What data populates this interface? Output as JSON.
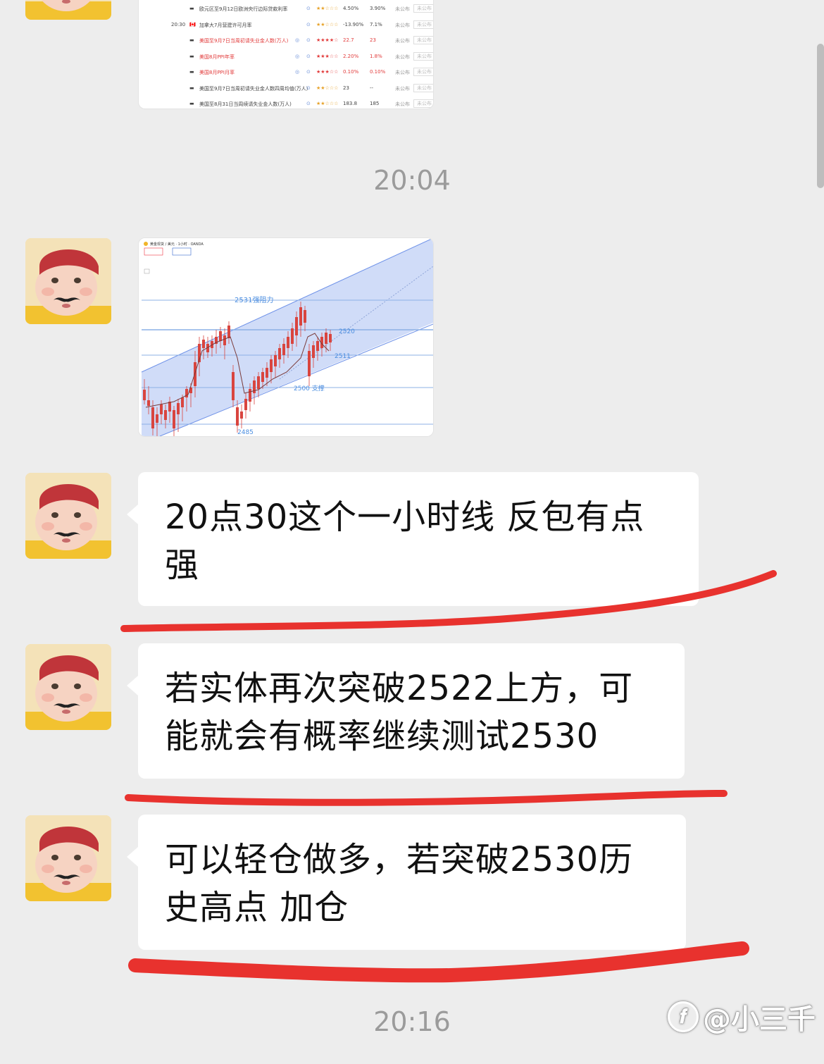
{
  "calendar": {
    "rows": [
      {
        "time": "",
        "flag": "eu",
        "event": "欧元区至9月12日欧洲央行边际贷款利率",
        "stars": "★★☆☆☆",
        "prev": "4.50%",
        "forecast": "3.90%",
        "actual": "未公布",
        "btn": "未公布",
        "red": false
      },
      {
        "time": "20:30",
        "flag": "ca",
        "event": "加拿大7月营建许可月率",
        "stars": "★★☆☆☆",
        "prev": "-13.90%",
        "forecast": "7.1%",
        "actual": "未公布",
        "btn": "未公布",
        "red": false
      },
      {
        "time": "",
        "flag": "us",
        "event": "美国至9月7日当周初请失业金人数(万人)",
        "stars": "★★★★☆",
        "prev": "22.7",
        "forecast": "23",
        "actual": "未公布",
        "btn": "未公布",
        "red": true
      },
      {
        "time": "",
        "flag": "us",
        "event": "美国8月PPI年率",
        "stars": "★★★☆☆",
        "prev": "2.20%",
        "forecast": "1.8%",
        "actual": "未公布",
        "btn": "未公布",
        "red": true
      },
      {
        "time": "",
        "flag": "us",
        "event": "美国8月PPI月率",
        "stars": "★★★☆☆",
        "prev": "0.10%",
        "forecast": "0.10%",
        "actual": "未公布",
        "btn": "未公布",
        "red": true
      },
      {
        "time": "",
        "flag": "us",
        "event": "美国至9月7日当周初请失业金人数四周均值(万人)",
        "stars": "★★☆☆☆",
        "prev": "23",
        "forecast": "--",
        "actual": "未公布",
        "btn": "未公布",
        "red": false
      },
      {
        "time": "",
        "flag": "us",
        "event": "美国至8月31日当周续请失业金人数(万人)",
        "stars": "★★☆☆☆",
        "prev": "183.8",
        "forecast": "185",
        "actual": "未公布",
        "btn": "未公布",
        "red": false
      }
    ]
  },
  "timestamps": {
    "first": "20:04",
    "second": "20:16"
  },
  "chart_image": {
    "header": "黄金现货 / 美元 · 1小时 · OANDA",
    "levels": {
      "resistance": "2531强阻力",
      "l2520": "2520",
      "l2511": "2511",
      "support": "2500 支撑",
      "low": "2485"
    }
  },
  "messages": [
    {
      "text": "20点30这个一小时线 反包有点\n强"
    },
    {
      "text": "若实体再次突破2522上方，可\n能就会有概率继续测试2530"
    },
    {
      "text": "可以轻仓做多，若突破2530历\n史高点 加仓"
    }
  ],
  "watermark": {
    "text": "@小三千",
    "logo": "头条-logo-icon"
  },
  "colors": {
    "background": "#ededed",
    "bubble": "#ffffff",
    "underline": "#e8322e",
    "channel": "#c8d6f7"
  }
}
